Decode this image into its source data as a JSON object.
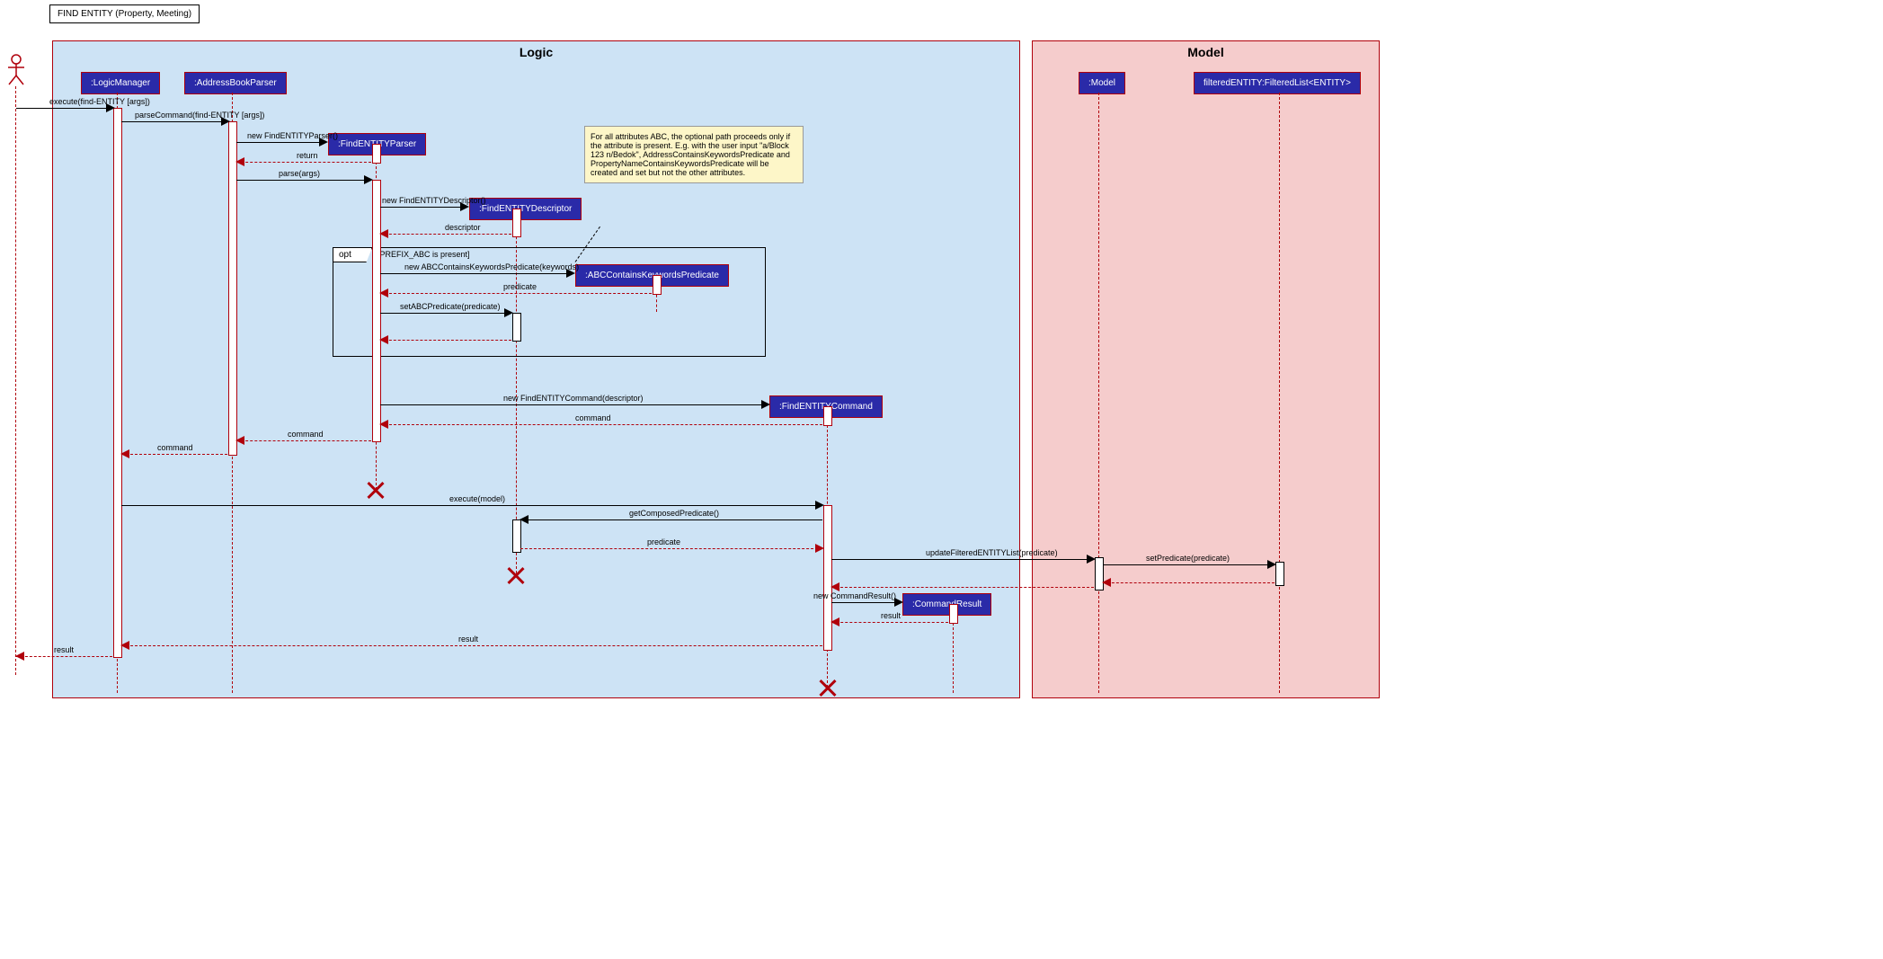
{
  "title": "FIND ENTITY (Property, Meeting)",
  "frames": {
    "logic": "Logic",
    "model": "Model"
  },
  "participants": {
    "logicManager": ":LogicManager",
    "addressBookParser": ":AddressBookParser",
    "findEntityParser": ":FindENTITYParser",
    "findEntityDescriptor": ":FindENTITYDescriptor",
    "abcPredicate": ":ABCContainsKeywordsPredicate",
    "findEntityCommand": ":FindENTITYCommand",
    "commandResult": ":CommandResult",
    "model": ":Model",
    "filteredEntity": "filteredENTITY:FilteredList<ENTITY>"
  },
  "note": "For all attributes ABC, the optional path proceeds only if the attribute is present. E.g. with the user input \"a/Block 123 n/Bedok\", AddressContainsKeywordsPredicate and PropertyNameContainsKeywordsPredicate will be created and set but not the other attributes.",
  "opt": {
    "label": "opt",
    "guard": "[PREFIX_ABC is present]"
  },
  "messages": {
    "execute": "execute(find-ENTITY [args])",
    "parseCommand": "parseCommand(find-ENTITY [args])",
    "newParser": "new FindENTITYParser()",
    "returnParser": "return",
    "parse": "parse(args)",
    "newDescriptor": "new FindENTITYDescriptor()",
    "descriptorReturn": "descriptor",
    "newPredicate": "new ABCContainsKeywordsPredicate(keywords)",
    "predicateReturn": "predicate",
    "setPredicate": "setABCPredicate(predicate)",
    "newCommand": "new FindENTITYCommand(descriptor)",
    "commandReturn": "command",
    "commandReturn2": "command",
    "commandReturn3": "command",
    "executeModel": "execute(model)",
    "getComposed": "getComposedPredicate()",
    "predicateReturn2": "predicate",
    "updateFiltered": "updateFilteredENTITYList(predicate)",
    "setPredicateModel": "setPredicate(predicate)",
    "newCommandResult": "new CommandResult()",
    "resultReturn": "result",
    "resultReturn2": "result",
    "resultReturn3": "result"
  }
}
